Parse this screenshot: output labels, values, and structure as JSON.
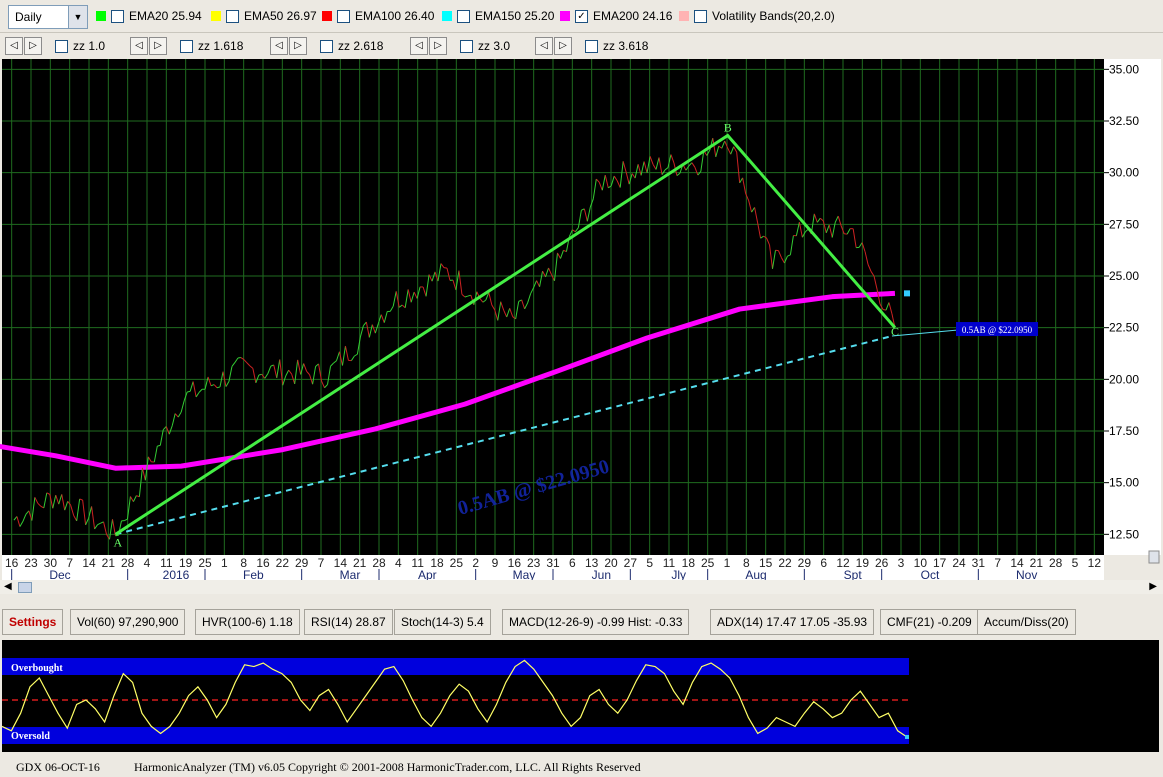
{
  "toolbar": {
    "period": "Daily",
    "indicators": [
      {
        "label": "EMA20 25.94",
        "color": "#00ff00",
        "checked": false
      },
      {
        "label": "EMA50 26.97",
        "color": "#ffff00",
        "checked": false
      },
      {
        "label": "EMA100 26.40",
        "color": "#ff0000",
        "checked": false
      },
      {
        "label": "EMA150 25.20",
        "color": "#00ffff",
        "checked": false
      },
      {
        "label": "EMA200 24.16",
        "color": "#ff00ff",
        "checked": true
      },
      {
        "label": "Volatility Bands(20,2.0)",
        "color": "#ffb3b3",
        "checked": false
      }
    ],
    "zigzag": [
      "zz 1.0",
      "zz 1.618",
      "zz 2.618",
      "zz 3.0",
      "zz 3.618"
    ]
  },
  "colors": {
    "price_up": "#33cc33",
    "price_down": "#cc2222",
    "ema200": "#ff00ff",
    "pattern": "#44ee44",
    "projection": "#55ddee",
    "band": "#0000dd"
  },
  "chart_data": {
    "type": "line",
    "ylim": [
      11.5,
      35.5
    ],
    "y_ticks": [
      "35.00",
      "32.50",
      "30.00",
      "27.50",
      "25.00",
      "22.50",
      "20.00",
      "17.50",
      "15.00",
      "12.50"
    ],
    "x_day_labels": [
      "16",
      "23",
      "30",
      "7",
      "14",
      "21",
      "28",
      "4",
      "11",
      "19",
      "25",
      "1",
      "8",
      "16",
      "22",
      "29",
      "7",
      "14",
      "21",
      "28",
      "4",
      "11",
      "18",
      "25",
      "2",
      "9",
      "16",
      "23",
      "31",
      "6",
      "13",
      "20",
      "27",
      "5",
      "11",
      "18",
      "25",
      "1",
      "8",
      "15",
      "22",
      "29",
      "6",
      "12",
      "19",
      "26",
      "3",
      "10",
      "17",
      "24",
      "31",
      "7",
      "14",
      "21",
      "28",
      "5",
      "12"
    ],
    "x_month_labels": [
      "Dec",
      "2016",
      "Feb",
      "Mar",
      "Apr",
      "May",
      "Jun",
      "Jly",
      "Aug",
      "Spt",
      "Oct",
      "Nov"
    ],
    "price": {
      "name": "Price",
      "dates": [
        "2015-12-16",
        "2015-12-30",
        "2016-01-19",
        "2016-02-10",
        "2016-03-01",
        "2016-03-30",
        "2016-04-21",
        "2016-05-09",
        "2016-05-31",
        "2016-06-15",
        "2016-06-30",
        "2016-07-12",
        "2016-08-01",
        "2016-08-11",
        "2016-08-26",
        "2016-09-07",
        "2016-09-22",
        "2016-10-06"
      ],
      "values": [
        13.2,
        14.4,
        12.5,
        19.0,
        20.5,
        20.2,
        23.8,
        25.2,
        22.8,
        25.5,
        29.6,
        30.2,
        30.5,
        31.8,
        25.5,
        27.5,
        27.2,
        22.5
      ]
    },
    "series": [
      {
        "name": "EMA200 24.16",
        "dates": [
          "2015-12-01",
          "2015-12-30",
          "2016-01-19",
          "2016-02-10",
          "2016-03-15",
          "2016-04-15",
          "2016-05-15",
          "2016-06-15",
          "2016-07-15",
          "2016-08-15",
          "2016-09-15",
          "2016-10-06"
        ],
        "values": [
          17.0,
          16.3,
          15.7,
          15.8,
          16.6,
          17.6,
          18.8,
          20.4,
          22.0,
          23.4,
          24.0,
          24.16
        ]
      }
    ],
    "pattern": {
      "points": [
        {
          "label": "A",
          "date": "2016-01-19",
          "value": 12.5
        },
        {
          "label": "B",
          "date": "2016-08-11",
          "value": 31.8
        },
        {
          "label": "C",
          "date": "2016-10-06",
          "value": 22.5
        }
      ]
    },
    "projection": {
      "from": {
        "date": "2016-01-19",
        "value": 12.5
      },
      "to": {
        "date": "2016-10-05",
        "value": 22.095
      },
      "watermark": "0.5AB @ $22.0950",
      "target_label": "0.5AB @ $22.0950"
    }
  },
  "statusbar": {
    "settings": "Settings",
    "items": [
      "Vol(60)  97,290,900",
      "HVR(100-6)   1.18",
      "RSI(14)  28.87",
      "Stoch(14-3)  5.4",
      "MACD(12-26-9)   -0.99  Hist:   -0.33",
      "ADX(14)  17.47   17.05   -35.93",
      "CMF(21)  -0.209",
      "Accum/Diss(20)"
    ]
  },
  "oscillator": {
    "overbought": "Overbought",
    "oversold": "Oversold",
    "values": [
      20,
      15,
      35,
      65,
      75,
      55,
      35,
      18,
      45,
      50,
      40,
      25,
      55,
      80,
      70,
      35,
      20,
      12,
      20,
      35,
      55,
      65,
      50,
      30,
      45,
      70,
      90,
      88,
      92,
      85,
      80,
      70,
      50,
      38,
      55,
      62,
      45,
      25,
      40,
      55,
      70,
      85,
      88,
      72,
      50,
      30,
      20,
      35,
      55,
      68,
      60,
      40,
      25,
      45,
      70,
      88,
      95,
      85,
      70,
      55,
      35,
      20,
      30,
      55,
      62,
      45,
      35,
      50,
      72,
      90,
      88,
      80,
      60,
      45,
      70,
      88,
      92,
      85,
      75,
      55,
      30,
      12,
      18,
      30,
      25,
      20,
      35,
      48,
      40,
      30,
      35,
      50,
      60,
      45,
      30,
      35,
      15,
      8
    ]
  },
  "footer": {
    "symbol": "GDX 06-OCT-16",
    "copyright": "HarmonicAnalyzer (TM) v6.05 Copyright © 2001-2008 HarmonicTrader.com, LLC. All Rights Reserved"
  }
}
